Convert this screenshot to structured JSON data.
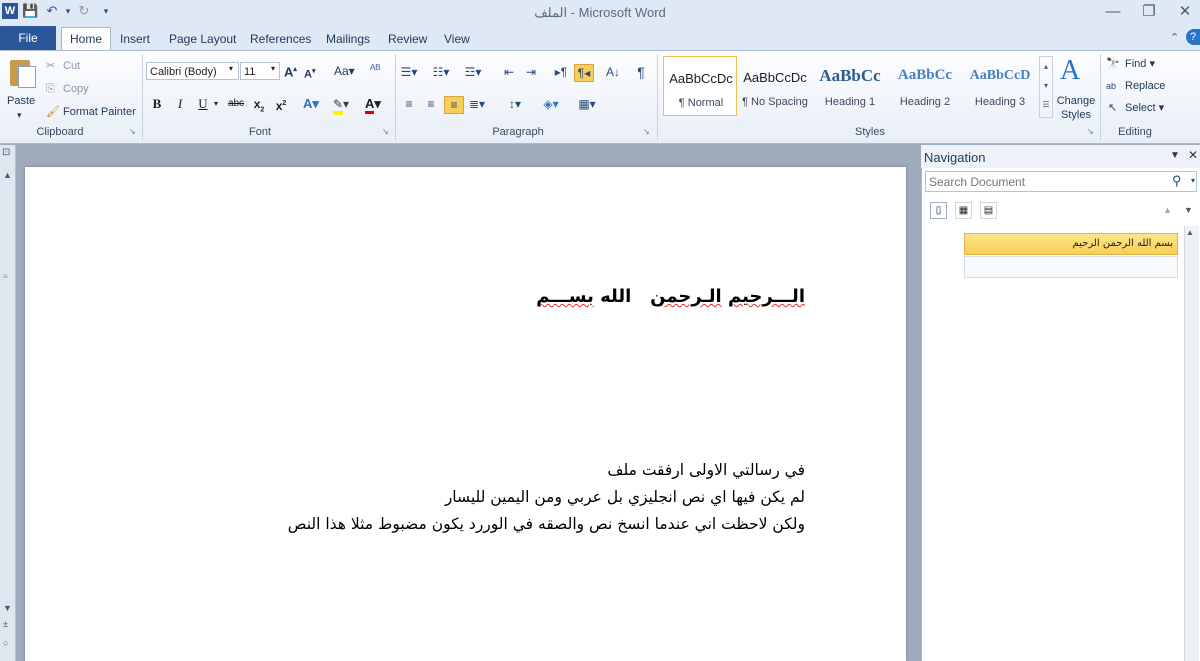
{
  "window": {
    "title": "الملف - Microsoft Word",
    "controls": {
      "minimize": "—",
      "restore": "❐",
      "close": "✕"
    }
  },
  "tabs": [
    "File",
    "Home",
    "Insert",
    "Page Layout",
    "References",
    "Mailings",
    "Review",
    "View"
  ],
  "clipboard": {
    "paste": "Paste",
    "cut": "Cut",
    "copy": "Copy",
    "format_painter": "Format Painter",
    "label": "Clipboard"
  },
  "font": {
    "name": "Calibri (Body)",
    "size": "11",
    "label": "Font"
  },
  "paragraph": {
    "label": "Paragraph"
  },
  "styles": {
    "items": [
      {
        "sample": "AaBbCcDc",
        "name": "¶ Normal"
      },
      {
        "sample": "AaBbCcDc",
        "name": "¶ No Spacing"
      },
      {
        "sample": "AaBbCc",
        "name": "Heading 1"
      },
      {
        "sample": "AaBbCc",
        "name": "Heading 2"
      },
      {
        "sample": "AaBbCcD",
        "name": "Heading 3"
      }
    ],
    "change_styles": "Change Styles",
    "label": "Styles"
  },
  "editing": {
    "find": "Find",
    "replace": "Replace",
    "select": "Select",
    "label": "Editing"
  },
  "document": {
    "heading_words": [
      "الـــرحيم",
      "الـرحمن",
      "الله",
      "بســـم"
    ],
    "lines": [
      "في رسالتي الاولى ارفقت ملف",
      "لم يكن فيها اي نص انجليزي بل عربي ومن اليمين لليسار",
      "ولكن لاحظت اني عندما انسخ نص والصقه في الوررد يكون مضبوط مثلا هذا النص"
    ]
  },
  "navigation": {
    "title": "Navigation",
    "search_placeholder": "Search Document",
    "heading_item": "بسم الله الرحمن الرحيم"
  }
}
